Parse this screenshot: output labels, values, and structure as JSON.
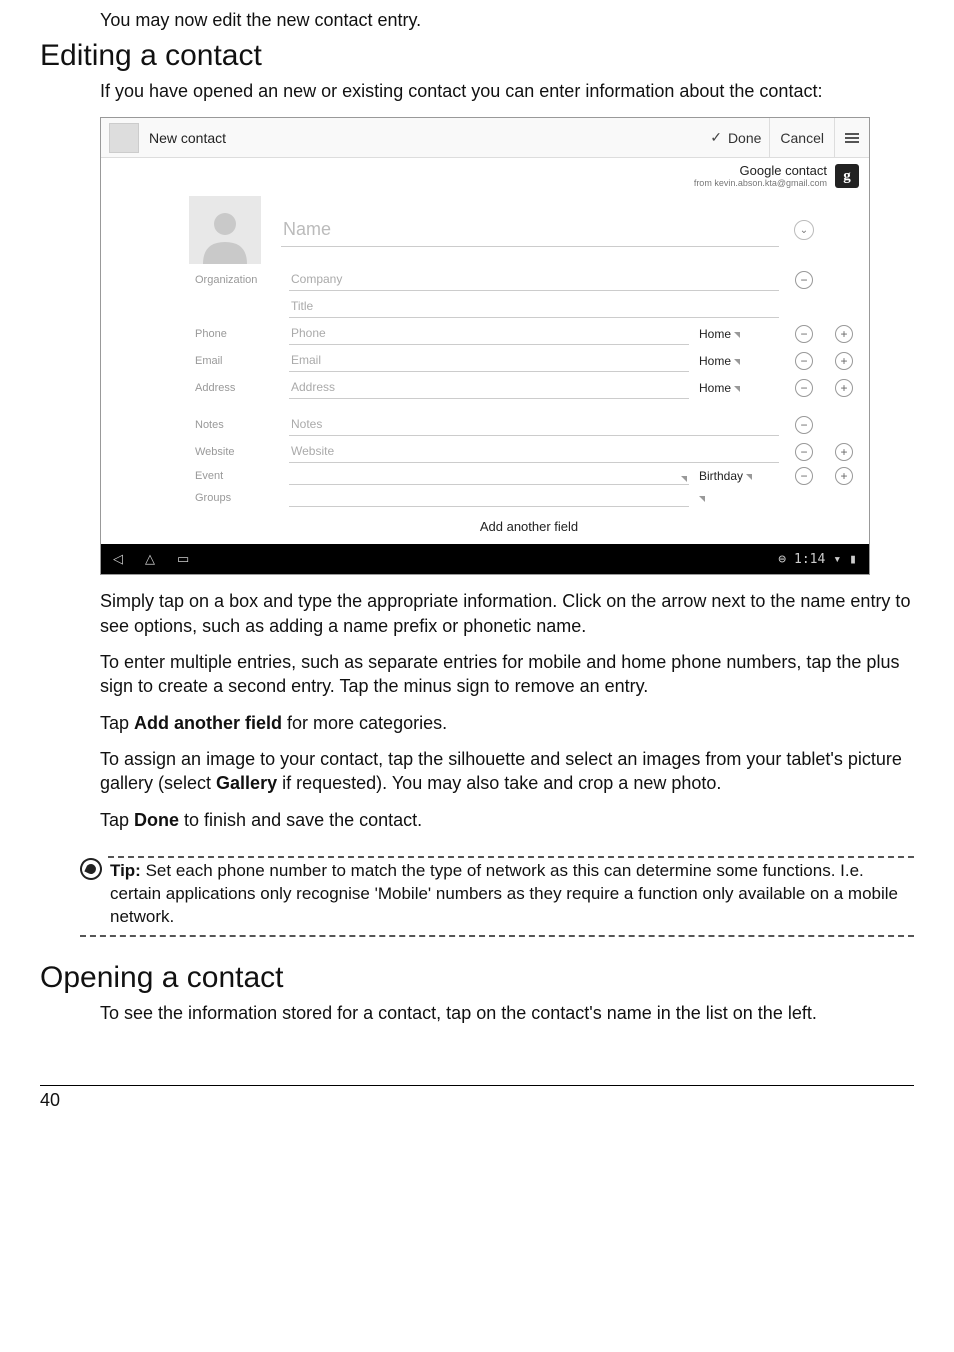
{
  "intro": "You may now edit the new contact entry.",
  "section1_heading": "Editing a contact",
  "section1_intro": "If you have opened an new or existing contact you can enter information about the contact:",
  "screenshot": {
    "headerTitle": "New contact",
    "doneLabel": "Done",
    "cancelLabel": "Cancel",
    "accountLine1": "Google contact",
    "accountLine2": "from kevin.abson.kta@gmail.com",
    "googleBadge": "g",
    "nameLabel": "Name",
    "orgRowLabel": "Organization",
    "companyLabel": "Company",
    "titleLabel": "Title",
    "phoneRowLabel": "Phone",
    "phoneInput": "Phone",
    "phoneType": "Home",
    "emailRowLabel": "Email",
    "emailInput": "Email",
    "emailType": "Home",
    "addressRowLabel": "Address",
    "addressInput": "Address",
    "addressType": "Home",
    "notesRowLabel": "Notes",
    "notesInput": "Notes",
    "websiteRowLabel": "Website",
    "websiteInput": "Website",
    "eventRowLabel": "Event",
    "eventType": "Birthday",
    "groupsRowLabel": "Groups",
    "addAnother": "Add another field",
    "clock": "1:14"
  },
  "para1": "Simply tap on a box and type the appropriate information. Click on the arrow next to the name entry to see options, such as adding a name prefix or phonetic name.",
  "para2": "To enter multiple entries, such as separate entries for mobile and home phone numbers, tap the plus sign to create a second entry. Tap the minus sign to remove an entry.",
  "para3_pre": "Tap ",
  "para3_bold": "Add another field",
  "para3_post": " for more categories.",
  "para4_pre": "To assign an image to your contact, tap the silhouette and select an images from your tablet's picture gallery (select ",
  "para4_bold": "Gallery",
  "para4_post": " if requested). You may also take and crop a new photo.",
  "para5_pre": "Tap ",
  "para5_bold": "Done",
  "para5_post": " to finish and save the contact.",
  "tip_label": "Tip:",
  "tip_text": " Set each phone number to match the type of network as this can determine some functions. I.e. certain applications only recognise 'Mobile' numbers as they require a function only available on a mobile network.",
  "section2_heading": "Opening a contact",
  "section2_para": "To see the information stored for a contact, tap on the contact's name in the list on the left.",
  "pageNumber": "40"
}
